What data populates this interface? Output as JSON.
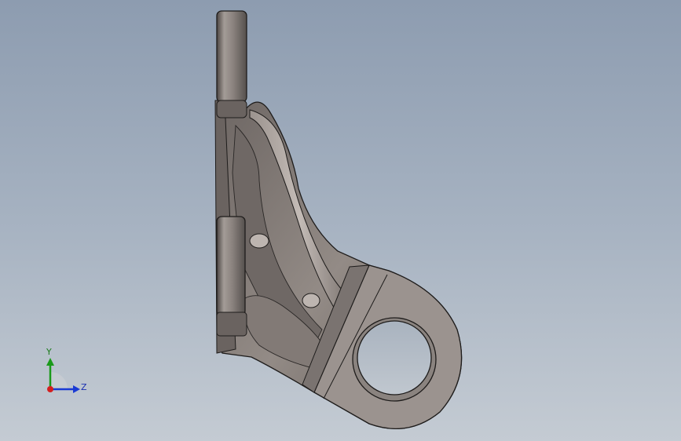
{
  "triad": {
    "y_label": "Y",
    "z_label": "Z",
    "x_color": "#d41f1f",
    "y_color": "#1a9a1a",
    "z_color": "#1a3ad4"
  },
  "colors": {
    "background_top": "#8d9cb0",
    "background_bottom": "#c4cbd3",
    "part_face": "#8c8480",
    "part_shadow": "#5a5350",
    "part_highlight": "#c9c2bd",
    "edge": "#1e1c1b"
  }
}
